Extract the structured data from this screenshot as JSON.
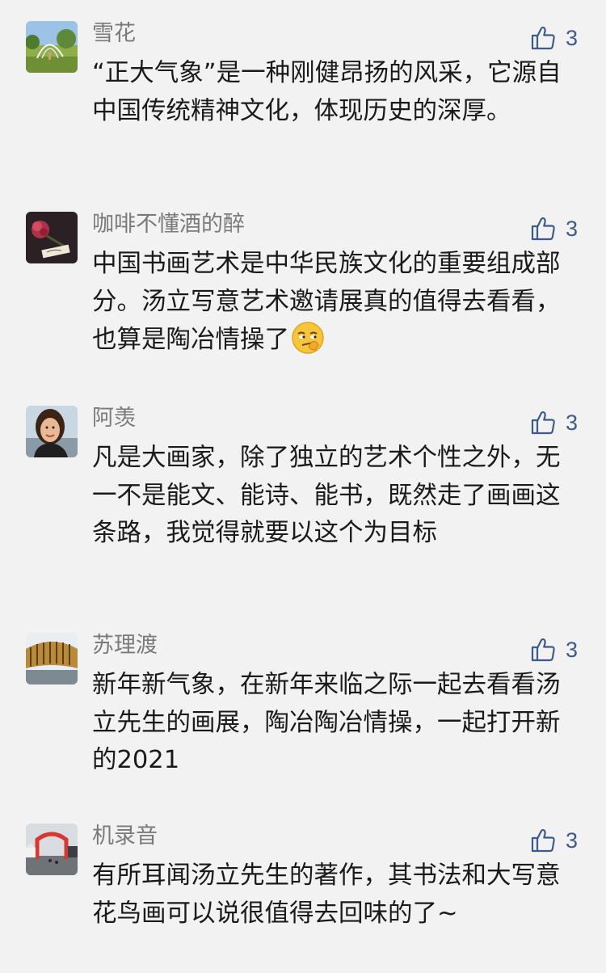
{
  "colors": {
    "background": "#f2f2f2",
    "name": "#7a7a7a",
    "text": "#1a1a1a",
    "accent": "#3d5a8c"
  },
  "comments": [
    {
      "user": "雪花",
      "avatar": "park-scene-avatar",
      "likes": "3",
      "text": "“正大气象”是一种刚健昂扬的风采，它源自中国传统精神文化，体现历史的深厚。"
    },
    {
      "user": "咖啡不懂酒的醉",
      "avatar": "rose-avatar",
      "likes": "3",
      "text": "中国书画艺术是中华民族文化的重要组成部分。汤立写意艺术邀请展真的值得去看看，也算是陶冶情操了",
      "emoji": "smirk-emoji"
    },
    {
      "user": "阿羡",
      "avatar": "girl-portrait-avatar",
      "likes": "3",
      "text": "凡是大画家，除了独立的艺术个性之外，无一不是能文、能诗、能书，既然走了画画这条路，我觉得就要以这个为目标"
    },
    {
      "user": "苏理渡",
      "avatar": "stadium-avatar",
      "likes": "3",
      "text": "新年新气象，在新年来临之际一起去看看汤立先生的画展，陶冶陶冶情操，一起打开新的2021"
    },
    {
      "user": "机录音",
      "avatar": "street-arch-avatar",
      "likes": "3",
      "text": "有所耳闻汤立先生的著作，其书法和大写意花鸟画可以说很值得去回味的了~"
    }
  ]
}
